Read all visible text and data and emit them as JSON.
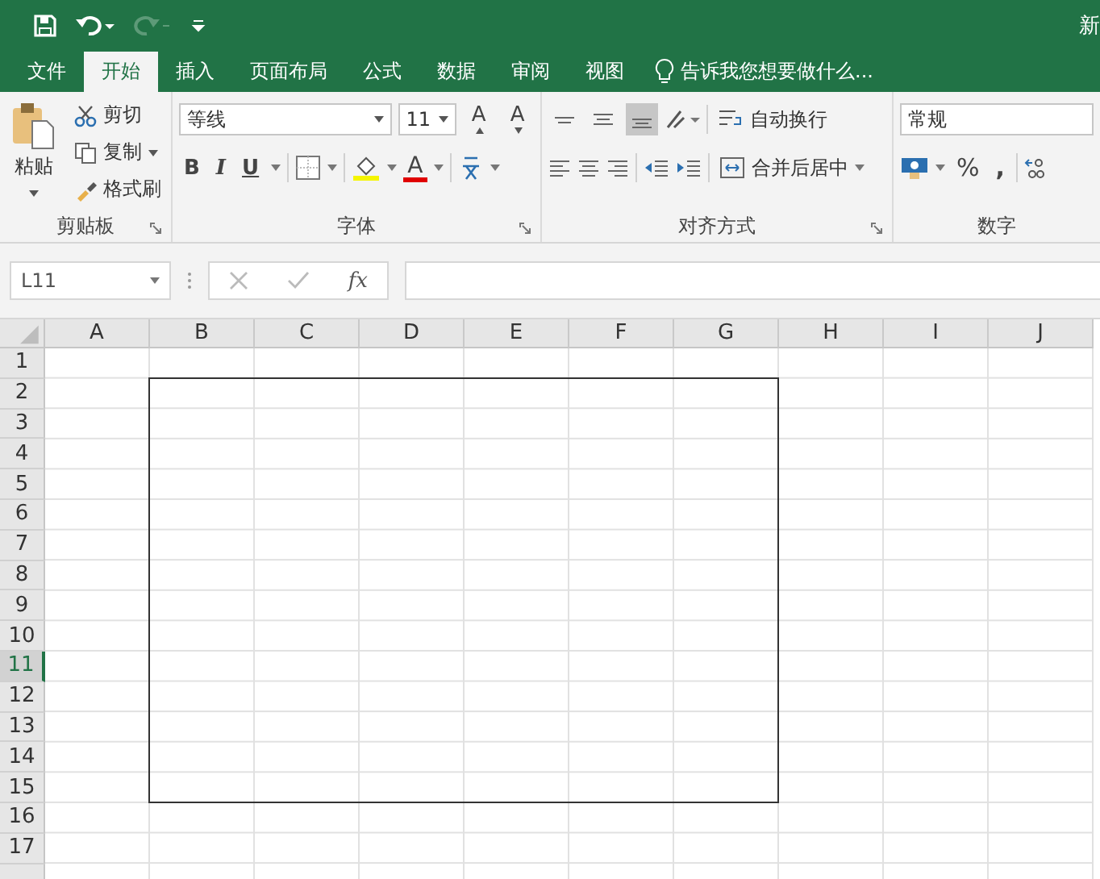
{
  "title_bar": {
    "title_fragment": "新"
  },
  "tabs": [
    {
      "label": "文件",
      "selected": false
    },
    {
      "label": "开始",
      "selected": true
    },
    {
      "label": "插入",
      "selected": false
    },
    {
      "label": "页面布局",
      "selected": false
    },
    {
      "label": "公式",
      "selected": false
    },
    {
      "label": "数据",
      "selected": false
    },
    {
      "label": "审阅",
      "selected": false
    },
    {
      "label": "视图",
      "selected": false
    }
  ],
  "tell_me": "告诉我您想要做什么...",
  "ribbon": {
    "clipboard": {
      "paste": "粘贴",
      "cut": "剪切",
      "copy": "复制",
      "format_painter": "格式刷",
      "label": "剪贴板"
    },
    "font": {
      "name": "等线",
      "size": "11",
      "grow": "A",
      "shrink": "A",
      "bold": "B",
      "italic": "I",
      "underline": "U",
      "font_color": "A",
      "label": "字体"
    },
    "alignment": {
      "vertical": [
        {
          "selected": false
        },
        {
          "selected": false
        },
        {
          "selected": true
        }
      ],
      "wrap": "自动换行",
      "merge": "合并后居中",
      "label": "对齐方式"
    },
    "number": {
      "format": "常规",
      "percent": "%",
      "comma": ",",
      "label": "数字"
    }
  },
  "formula_bar": {
    "name_box": "L11",
    "fx": "fx"
  },
  "sheet": {
    "columns": [
      {
        "label": "A"
      },
      {
        "label": "B"
      },
      {
        "label": "C"
      },
      {
        "label": "D"
      },
      {
        "label": "E"
      },
      {
        "label": "F"
      },
      {
        "label": "G"
      },
      {
        "label": "H"
      },
      {
        "label": "I"
      },
      {
        "label": "J"
      }
    ],
    "rows": [
      {
        "label": "1",
        "selected": false
      },
      {
        "label": "2",
        "selected": false
      },
      {
        "label": "3",
        "selected": false
      },
      {
        "label": "4",
        "selected": false
      },
      {
        "label": "5",
        "selected": false
      },
      {
        "label": "6",
        "selected": false
      },
      {
        "label": "7",
        "selected": false
      },
      {
        "label": "8",
        "selected": false
      },
      {
        "label": "9",
        "selected": false
      },
      {
        "label": "10",
        "selected": false
      },
      {
        "label": "11",
        "selected": true
      },
      {
        "label": "12",
        "selected": false
      },
      {
        "label": "13",
        "selected": false
      },
      {
        "label": "14",
        "selected": false
      },
      {
        "label": "15",
        "selected": false
      },
      {
        "label": "16",
        "selected": false
      },
      {
        "label": "17",
        "selected": false
      }
    ]
  }
}
